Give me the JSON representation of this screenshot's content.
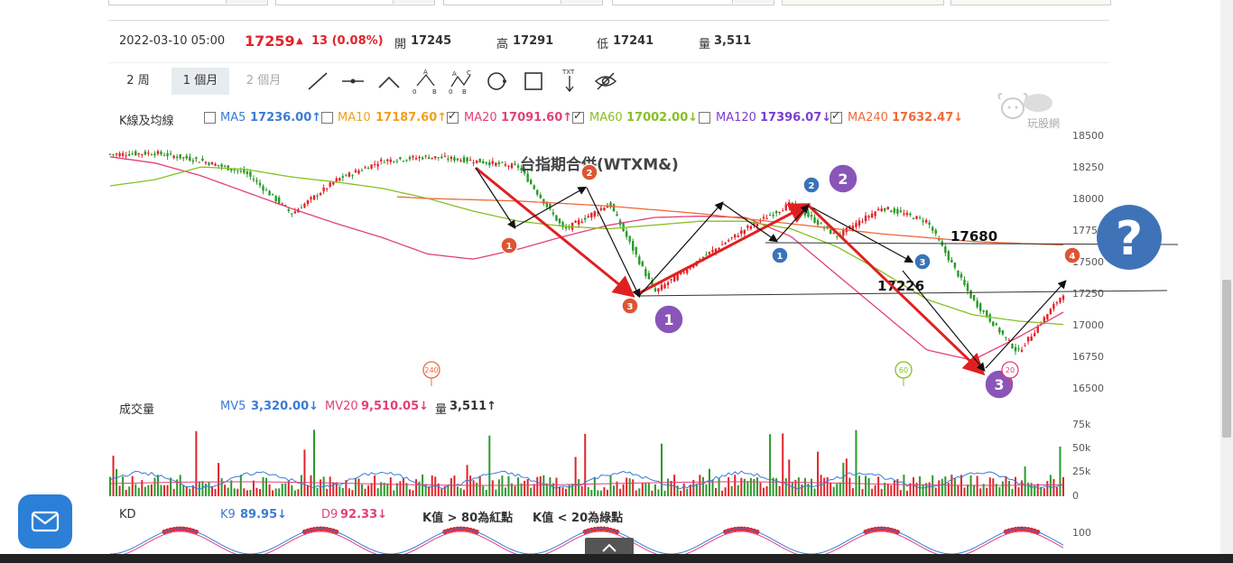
{
  "info": {
    "datetime": "2022-03-10 05:00",
    "price": "17259",
    "change": "13 (0.08%)",
    "open_label": "開",
    "open": "17245",
    "high_label": "高",
    "high": "17291",
    "low_label": "低",
    "low": "17241",
    "vol_label": "量",
    "vol": "3,511"
  },
  "tabs": [
    "2 周",
    "1 個月",
    "2 個月"
  ],
  "tools": [
    "line-tool-icon",
    "segment-tool-icon",
    "angle-tool-icon",
    "abc-pattern-icon",
    "abcd-pattern-icon",
    "circle-tool-icon",
    "rectangle-tool-icon",
    "text-tool-icon",
    "hide-drawings-icon"
  ],
  "tool_labels": {
    "a": "A",
    "b": "B",
    "c": "C",
    "zero": "0",
    "txt": "TXT"
  },
  "ma_legend": {
    "title": "K線及均線",
    "items": [
      {
        "label": "MA5",
        "value": "17236.00↑",
        "checked": false,
        "color": "#3a7bd5"
      },
      {
        "label": "MA10",
        "value": "17187.60↑",
        "checked": false,
        "color": "#f0a020"
      },
      {
        "label": "MA20",
        "value": "17091.60↑",
        "checked": true,
        "color": "#e2407a"
      },
      {
        "label": "MA60",
        "value": "17002.00↓",
        "checked": true,
        "color": "#86c024"
      },
      {
        "label": "MA120",
        "value": "17396.07↓",
        "checked": false,
        "color": "#7b3fd0"
      },
      {
        "label": "MA240",
        "value": "17632.47↓",
        "checked": true,
        "color": "#f06a3a"
      }
    ]
  },
  "watermark": "玩股網",
  "price_chart": {
    "title": "台指期合併(WTXM&)",
    "y_ticks": [
      "18500",
      "18250",
      "18000",
      "17750",
      "17500",
      "17250",
      "17000",
      "16750",
      "16500"
    ],
    "annotations": {
      "level_high": "17680",
      "level_low": "17226",
      "q": "?",
      "ma_badge_240": "240",
      "ma_badge_60": "60",
      "ma_badge_20": "20"
    },
    "wave_markers": [
      "1",
      "2",
      "3",
      "1",
      "2",
      "3",
      "1",
      "2",
      "3",
      "4"
    ]
  },
  "volume": {
    "title": "成交量",
    "mv5": "MV5",
    "mv5_value": "3,320.00↓",
    "mv20": "MV20",
    "mv20_value": "9,510.05↓",
    "vol_label": "量",
    "vol_value": "3,511↑",
    "y_ticks": [
      "75k",
      "50k",
      "25k",
      "0"
    ]
  },
  "kd": {
    "title": "KD",
    "k9": "K9",
    "k9_value": "89.95↓",
    "d9": "D9",
    "d9_value": "92.33↓",
    "note1": "K值 > 80為紅點",
    "note2": "K值 < 20為綠點",
    "y_tick": "100"
  },
  "chart_data": {
    "type": "line",
    "title": "台指期合併(WTXM&)",
    "ylim": [
      16500,
      18500
    ],
    "series": [
      {
        "name": "MA20",
        "values": [
          18330,
          18280,
          18180,
          18050,
          17920,
          17800,
          17690,
          17560,
          17520,
          17600,
          17700,
          17790,
          17850,
          17860,
          17850,
          17700,
          17400,
          17100,
          16800,
          16720,
          16900,
          17100
        ]
      },
      {
        "name": "MA60",
        "values": [
          18100,
          18150,
          18250,
          18230,
          18170,
          18130,
          18080,
          18000,
          17900,
          17820,
          17780,
          17760,
          17790,
          17820,
          17820,
          17760,
          17620,
          17420,
          17200,
          17080,
          17030,
          17002
        ]
      },
      {
        "name": "MA240",
        "values": [
          18030,
          18040,
          18060,
          18060,
          18050,
          18040,
          18020,
          18000,
          17990,
          17980,
          17960,
          17940,
          17910,
          17880,
          17840,
          17800,
          17760,
          17720,
          17690,
          17660,
          17645,
          17632
        ]
      }
    ],
    "price_path": [
      18350,
      18360,
      18300,
      18200,
      17880,
      18150,
      18300,
      18330,
      18300,
      18250,
      17750,
      17960,
      17260,
      17520,
      17760,
      17960,
      17700,
      17930,
      17820,
      17200,
      16780,
      17250
    ]
  }
}
